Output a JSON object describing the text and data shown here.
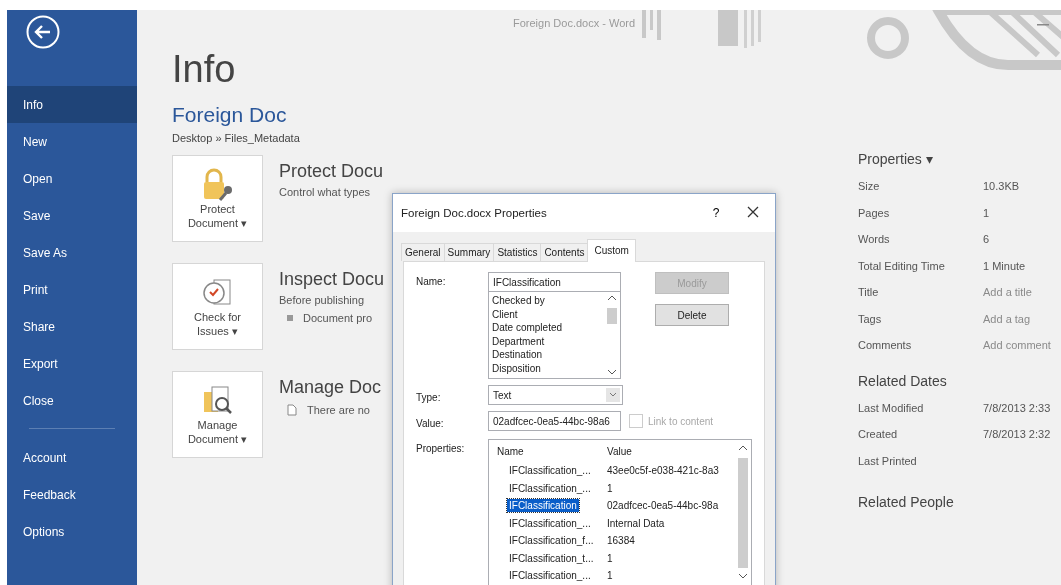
{
  "window": {
    "title": "Foreign Doc.docx  -  Word"
  },
  "sidebar": {
    "items": [
      {
        "label": "Info",
        "selected": true
      },
      {
        "label": "New",
        "selected": false
      },
      {
        "label": "Open",
        "selected": false
      },
      {
        "label": "Save",
        "selected": false
      },
      {
        "label": "Save As",
        "selected": false
      },
      {
        "label": "Print",
        "selected": false
      },
      {
        "label": "Share",
        "selected": false
      },
      {
        "label": "Export",
        "selected": false
      },
      {
        "label": "Close",
        "selected": false
      }
    ],
    "bottom_items": [
      {
        "label": "Account",
        "selected": false
      },
      {
        "label": "Feedback",
        "selected": false
      },
      {
        "label": "Options",
        "selected": false
      }
    ]
  },
  "main": {
    "heading": "Info",
    "doc_title": "Foreign Doc",
    "path": "Desktop » Files_Metadata",
    "sections": [
      {
        "kind": "protect",
        "button_lines": [
          "Protect",
          "Document ▾"
        ],
        "title": "Protect Docu",
        "description": "Control what types"
      },
      {
        "kind": "inspect",
        "button_lines": [
          "Check for",
          "Issues ▾"
        ],
        "title": "Inspect Docu",
        "description": "Before publishing",
        "bullet": "Document pro"
      },
      {
        "kind": "manage",
        "button_lines": [
          "Manage",
          "Document ▾"
        ],
        "title": "Manage Doc",
        "note": "There are no"
      }
    ]
  },
  "dialog": {
    "title": "Foreign Doc.docx Properties",
    "help": "?",
    "tabs": [
      {
        "label": "General",
        "selected": false
      },
      {
        "label": "Summary",
        "selected": false
      },
      {
        "label": "Statistics",
        "selected": false
      },
      {
        "label": "Contents",
        "selected": false
      },
      {
        "label": "Custom",
        "selected": true
      }
    ],
    "name_label": "Name:",
    "name_value": "IFClassification",
    "name_list": [
      "Checked by",
      "Client",
      "Date completed",
      "Department",
      "Destination",
      "Disposition"
    ],
    "buttons": [
      {
        "label": "Modify",
        "disabled": true
      },
      {
        "label": "Delete",
        "disabled": false
      }
    ],
    "type_label": "Type:",
    "type_value": "Text",
    "value_label": "Value:",
    "value_value": "02adfcec-0ea5-44bc-98a6",
    "link": {
      "label": "Link to content",
      "checked": false,
      "disabled": true
    },
    "properties_label": "Properties:",
    "columns": [
      "Name",
      "Value"
    ],
    "rows": [
      {
        "name": "IFClassification_...",
        "value": "43ee0c5f-e038-421c-8a3",
        "selected": false
      },
      {
        "name": "IFClassification_...",
        "value": "1",
        "selected": false
      },
      {
        "name": "IFClassification",
        "value": "02adfcec-0ea5-44bc-98a",
        "selected": true
      },
      {
        "name": "IFClassification_...",
        "value": "Internal Data",
        "selected": false
      },
      {
        "name": "IFClassification_f...",
        "value": "16384",
        "selected": false
      },
      {
        "name": "IFClassification_t...",
        "value": "1",
        "selected": false
      },
      {
        "name": "IFClassification_...",
        "value": "1",
        "selected": false
      }
    ]
  },
  "info_panel": {
    "properties_heading": "Properties ▾",
    "properties": [
      {
        "label": "Size",
        "value": "10.3KB"
      },
      {
        "label": "Pages",
        "value": "1"
      },
      {
        "label": "Words",
        "value": "6"
      },
      {
        "label": "Total Editing Time",
        "value": "1 Minute"
      },
      {
        "label": "Title",
        "placeholder": "Add a title"
      },
      {
        "label": "Tags",
        "placeholder": "Add a tag"
      },
      {
        "label": "Comments",
        "placeholder": "Add comment"
      }
    ],
    "dates_heading": "Related Dates",
    "dates": [
      {
        "label": "Last Modified",
        "value": "7/8/2013 2:33"
      },
      {
        "label": "Created",
        "value": "7/8/2013 2:32"
      },
      {
        "label": "Last Printed"
      }
    ],
    "people_heading": "Related People"
  }
}
